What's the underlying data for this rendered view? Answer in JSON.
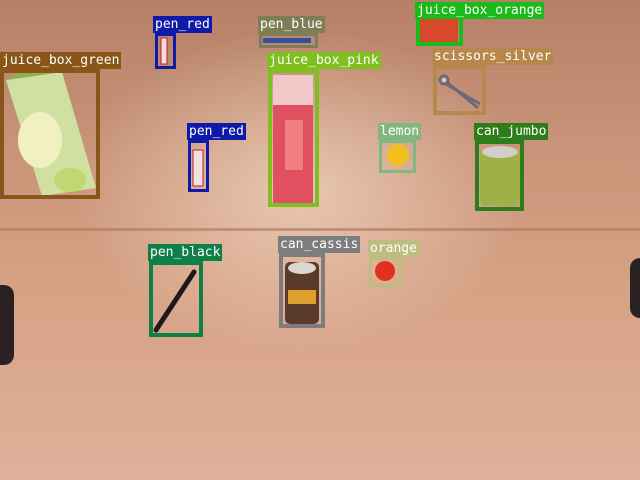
{
  "detections": [
    {
      "label": "pen_red",
      "color": "#0f1aa8"
    },
    {
      "label": "pen_blue",
      "color": "#7f7d55"
    },
    {
      "label": "juice_box_orange",
      "color": "#1aba1a"
    },
    {
      "label": "juice_box_green",
      "color": "#8a5518"
    },
    {
      "label": "juice_box_pink",
      "color": "#7fbf1f"
    },
    {
      "label": "scissors_silver",
      "color": "#b8874b"
    },
    {
      "label": "pen_red",
      "color": "#0f1aa8"
    },
    {
      "label": "lemon",
      "color": "#80b880"
    },
    {
      "label": "can_jumbo",
      "color": "#2f7d1a"
    },
    {
      "label": "pen_black",
      "color": "#0f7f48"
    },
    {
      "label": "can_cassis",
      "color": "#7d7d7d"
    },
    {
      "label": "orange",
      "color": "#bdbd80"
    }
  ]
}
